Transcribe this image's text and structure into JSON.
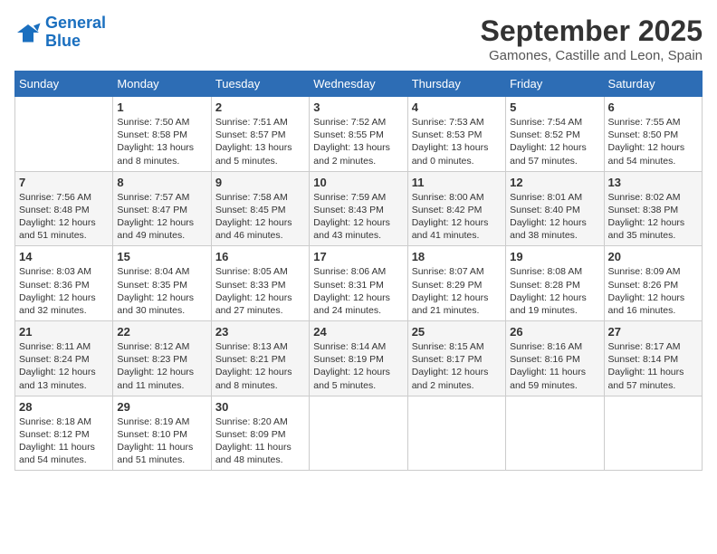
{
  "logo": {
    "line1": "General",
    "line2": "Blue"
  },
  "title": "September 2025",
  "subtitle": "Gamones, Castille and Leon, Spain",
  "days_header": [
    "Sunday",
    "Monday",
    "Tuesday",
    "Wednesday",
    "Thursday",
    "Friday",
    "Saturday"
  ],
  "weeks": [
    [
      {
        "day": "",
        "text": ""
      },
      {
        "day": "1",
        "text": "Sunrise: 7:50 AM\nSunset: 8:58 PM\nDaylight: 13 hours\nand 8 minutes."
      },
      {
        "day": "2",
        "text": "Sunrise: 7:51 AM\nSunset: 8:57 PM\nDaylight: 13 hours\nand 5 minutes."
      },
      {
        "day": "3",
        "text": "Sunrise: 7:52 AM\nSunset: 8:55 PM\nDaylight: 13 hours\nand 2 minutes."
      },
      {
        "day": "4",
        "text": "Sunrise: 7:53 AM\nSunset: 8:53 PM\nDaylight: 13 hours\nand 0 minutes."
      },
      {
        "day": "5",
        "text": "Sunrise: 7:54 AM\nSunset: 8:52 PM\nDaylight: 12 hours\nand 57 minutes."
      },
      {
        "day": "6",
        "text": "Sunrise: 7:55 AM\nSunset: 8:50 PM\nDaylight: 12 hours\nand 54 minutes."
      }
    ],
    [
      {
        "day": "7",
        "text": "Sunrise: 7:56 AM\nSunset: 8:48 PM\nDaylight: 12 hours\nand 51 minutes."
      },
      {
        "day": "8",
        "text": "Sunrise: 7:57 AM\nSunset: 8:47 PM\nDaylight: 12 hours\nand 49 minutes."
      },
      {
        "day": "9",
        "text": "Sunrise: 7:58 AM\nSunset: 8:45 PM\nDaylight: 12 hours\nand 46 minutes."
      },
      {
        "day": "10",
        "text": "Sunrise: 7:59 AM\nSunset: 8:43 PM\nDaylight: 12 hours\nand 43 minutes."
      },
      {
        "day": "11",
        "text": "Sunrise: 8:00 AM\nSunset: 8:42 PM\nDaylight: 12 hours\nand 41 minutes."
      },
      {
        "day": "12",
        "text": "Sunrise: 8:01 AM\nSunset: 8:40 PM\nDaylight: 12 hours\nand 38 minutes."
      },
      {
        "day": "13",
        "text": "Sunrise: 8:02 AM\nSunset: 8:38 PM\nDaylight: 12 hours\nand 35 minutes."
      }
    ],
    [
      {
        "day": "14",
        "text": "Sunrise: 8:03 AM\nSunset: 8:36 PM\nDaylight: 12 hours\nand 32 minutes."
      },
      {
        "day": "15",
        "text": "Sunrise: 8:04 AM\nSunset: 8:35 PM\nDaylight: 12 hours\nand 30 minutes."
      },
      {
        "day": "16",
        "text": "Sunrise: 8:05 AM\nSunset: 8:33 PM\nDaylight: 12 hours\nand 27 minutes."
      },
      {
        "day": "17",
        "text": "Sunrise: 8:06 AM\nSunset: 8:31 PM\nDaylight: 12 hours\nand 24 minutes."
      },
      {
        "day": "18",
        "text": "Sunrise: 8:07 AM\nSunset: 8:29 PM\nDaylight: 12 hours\nand 21 minutes."
      },
      {
        "day": "19",
        "text": "Sunrise: 8:08 AM\nSunset: 8:28 PM\nDaylight: 12 hours\nand 19 minutes."
      },
      {
        "day": "20",
        "text": "Sunrise: 8:09 AM\nSunset: 8:26 PM\nDaylight: 12 hours\nand 16 minutes."
      }
    ],
    [
      {
        "day": "21",
        "text": "Sunrise: 8:11 AM\nSunset: 8:24 PM\nDaylight: 12 hours\nand 13 minutes."
      },
      {
        "day": "22",
        "text": "Sunrise: 8:12 AM\nSunset: 8:23 PM\nDaylight: 12 hours\nand 11 minutes."
      },
      {
        "day": "23",
        "text": "Sunrise: 8:13 AM\nSunset: 8:21 PM\nDaylight: 12 hours\nand 8 minutes."
      },
      {
        "day": "24",
        "text": "Sunrise: 8:14 AM\nSunset: 8:19 PM\nDaylight: 12 hours\nand 5 minutes."
      },
      {
        "day": "25",
        "text": "Sunrise: 8:15 AM\nSunset: 8:17 PM\nDaylight: 12 hours\nand 2 minutes."
      },
      {
        "day": "26",
        "text": "Sunrise: 8:16 AM\nSunset: 8:16 PM\nDaylight: 11 hours\nand 59 minutes."
      },
      {
        "day": "27",
        "text": "Sunrise: 8:17 AM\nSunset: 8:14 PM\nDaylight: 11 hours\nand 57 minutes."
      }
    ],
    [
      {
        "day": "28",
        "text": "Sunrise: 8:18 AM\nSunset: 8:12 PM\nDaylight: 11 hours\nand 54 minutes."
      },
      {
        "day": "29",
        "text": "Sunrise: 8:19 AM\nSunset: 8:10 PM\nDaylight: 11 hours\nand 51 minutes."
      },
      {
        "day": "30",
        "text": "Sunrise: 8:20 AM\nSunset: 8:09 PM\nDaylight: 11 hours\nand 48 minutes."
      },
      {
        "day": "",
        "text": ""
      },
      {
        "day": "",
        "text": ""
      },
      {
        "day": "",
        "text": ""
      },
      {
        "day": "",
        "text": ""
      }
    ]
  ]
}
